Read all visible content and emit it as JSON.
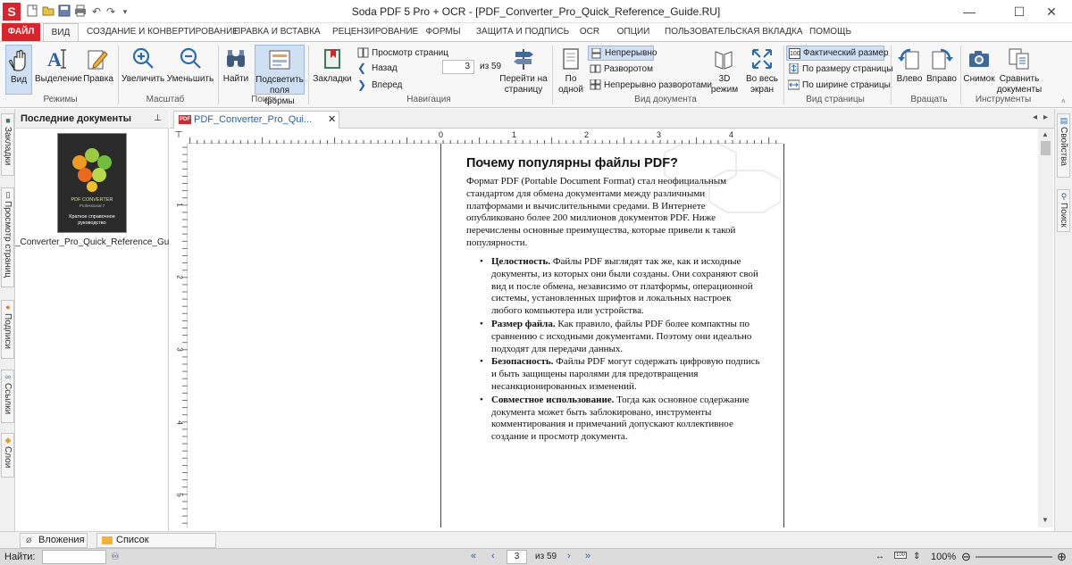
{
  "window": {
    "title": "Soda PDF 5 Pro + OCR - [PDF_Converter_Pro_Quick_Reference_Guide.RU]",
    "app_logo": "S"
  },
  "ribbon_tabs": [
    "ФАЙЛ",
    "ВИД",
    "СОЗДАНИЕ И КОНВЕРТИРОВАНИЕ",
    "ПРАВКА И ВСТАВКА",
    "РЕЦЕНЗИРОВАНИЕ",
    "ФОРМЫ",
    "ЗАЩИТА И ПОДПИСЬ",
    "OCR",
    "ОПЦИИ",
    "ПОЛЬЗОВАТЕЛЬСКАЯ ВКЛАДКА",
    "ПОМОЩЬ"
  ],
  "ribbon": {
    "modes": {
      "group": "Режимы",
      "view": "Вид",
      "select": "Выделение",
      "edit": "Правка"
    },
    "zoom": {
      "group": "Масштаб",
      "in": "Увеличить",
      "out": "Уменьшить"
    },
    "search": {
      "group": "Поиск",
      "find": "Найти",
      "highlight": "Подсветить поля формы"
    },
    "nav": {
      "group": "Навигация",
      "bookmarks": "Закладки",
      "thumbs": "Просмотр страниц",
      "back": "Назад",
      "forward": "Вперед",
      "page": "3",
      "of": "из 59",
      "goto": "Перейти на страницу"
    },
    "docview": {
      "group": "Вид документа",
      "single": "По одной",
      "continuous": "Непрерывно",
      "spread": "Разворотом",
      "cont_spread": "Непрерывно разворотами",
      "mode3d": "3D режим",
      "fullscreen": "Во весь экран"
    },
    "pageview": {
      "group": "Вид страницы",
      "actual": "Фактический размер",
      "fit_page": "По размеру страницы",
      "fit_width": "По ширине страницы"
    },
    "rotate": {
      "group": "Вращать",
      "left": "Влево",
      "right": "Вправо"
    },
    "tools": {
      "group": "Инструменты",
      "snapshot": "Снимок",
      "compare": "Сравнить документы"
    }
  },
  "left_tabs": [
    "Закладки",
    "Просмотр страниц",
    "Подписи",
    "Ссылки",
    "Слои"
  ],
  "right_tabs": [
    "Свойства",
    "Поиск"
  ],
  "recent": {
    "title": "Последние документы",
    "items": [
      {
        "filename": "_Converter_Pro_Quick_Reference_Guide.RU",
        "cover_title": "PDF CONVERTER",
        "cover_sub": "Professional 7",
        "cover_caption": "Краткое справочное руководство"
      }
    ]
  },
  "doc_tab": {
    "label": "PDF_Converter_Pro_Qui..."
  },
  "ruler": {
    "h": [
      "0",
      "1",
      "2",
      "3",
      "4"
    ],
    "v": [
      "1",
      "2",
      "3",
      "4",
      "5"
    ]
  },
  "doc": {
    "heading": "Почему популярны файлы PDF?",
    "intro": "Формат PDF (Portable Document Format) стал неофициальным стандартом для обмена документами между различными платформами и вычислительными средами. В Интернете опубликовано более 200 миллионов документов PDF. Ниже перечислены основные преимущества, которые привели к такой популярности.",
    "bullets": [
      {
        "b": "Целостность.",
        "t": " Файлы PDF выглядят так же, как и исходные документы, из которых они были созданы. Они сохраняют свой вид и после обмена, независимо от платформы, операционной системы, установленных шрифтов и локальных настроек любого компьютера или устройства."
      },
      {
        "b": "Размер файла.",
        "t": " Как правило, файлы PDF более компактны по сравнению с исходными документами. Поэтому они идеально подходят для передачи данных."
      },
      {
        "b": "Безопасность.",
        "t": " Файлы PDF могут содержать цифровую подпись и быть защищены паролями для предотвращения несанкционированных изменений."
      },
      {
        "b": "Совместное использование.",
        "t": " Тогда как основное содержание документа может быть заблокировано, инструменты комментирования и примечаний допускают коллективное создание и просмотр документа."
      }
    ]
  },
  "bottom_tabs": {
    "attachments": "Вложения",
    "comments": "Список комментариев"
  },
  "status": {
    "find_label": "Найти:",
    "find_value": "",
    "page": "3",
    "of": "из 59",
    "zoom": "100%"
  },
  "colors": {
    "brand": "#d9242b",
    "selected": "#cfe0f4",
    "accent_blue": "#2b6cb0"
  }
}
